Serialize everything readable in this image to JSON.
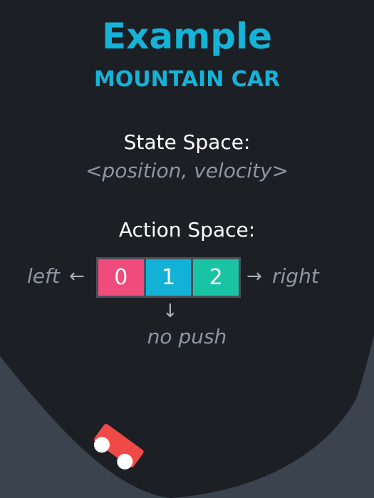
{
  "title": "Example",
  "subtitle": "MOUNTAIN CAR",
  "state_space": {
    "label": "State Space:",
    "value": "<position, velocity>"
  },
  "action_space": {
    "label": "Action Space:",
    "actions": [
      {
        "value": "0",
        "color": "#ef4b7b"
      },
      {
        "value": "1",
        "color": "#13b1d6"
      },
      {
        "value": "2",
        "color": "#19c4a5"
      }
    ],
    "left_label": "left",
    "right_label": "right",
    "middle_label": "no push"
  },
  "arrows": {
    "left": "←",
    "right": "→",
    "down": "↓"
  },
  "colors": {
    "background": "#1c1f24",
    "hill": "#3d4752",
    "accent": "#15b3d8",
    "car": "#ef4a45"
  }
}
